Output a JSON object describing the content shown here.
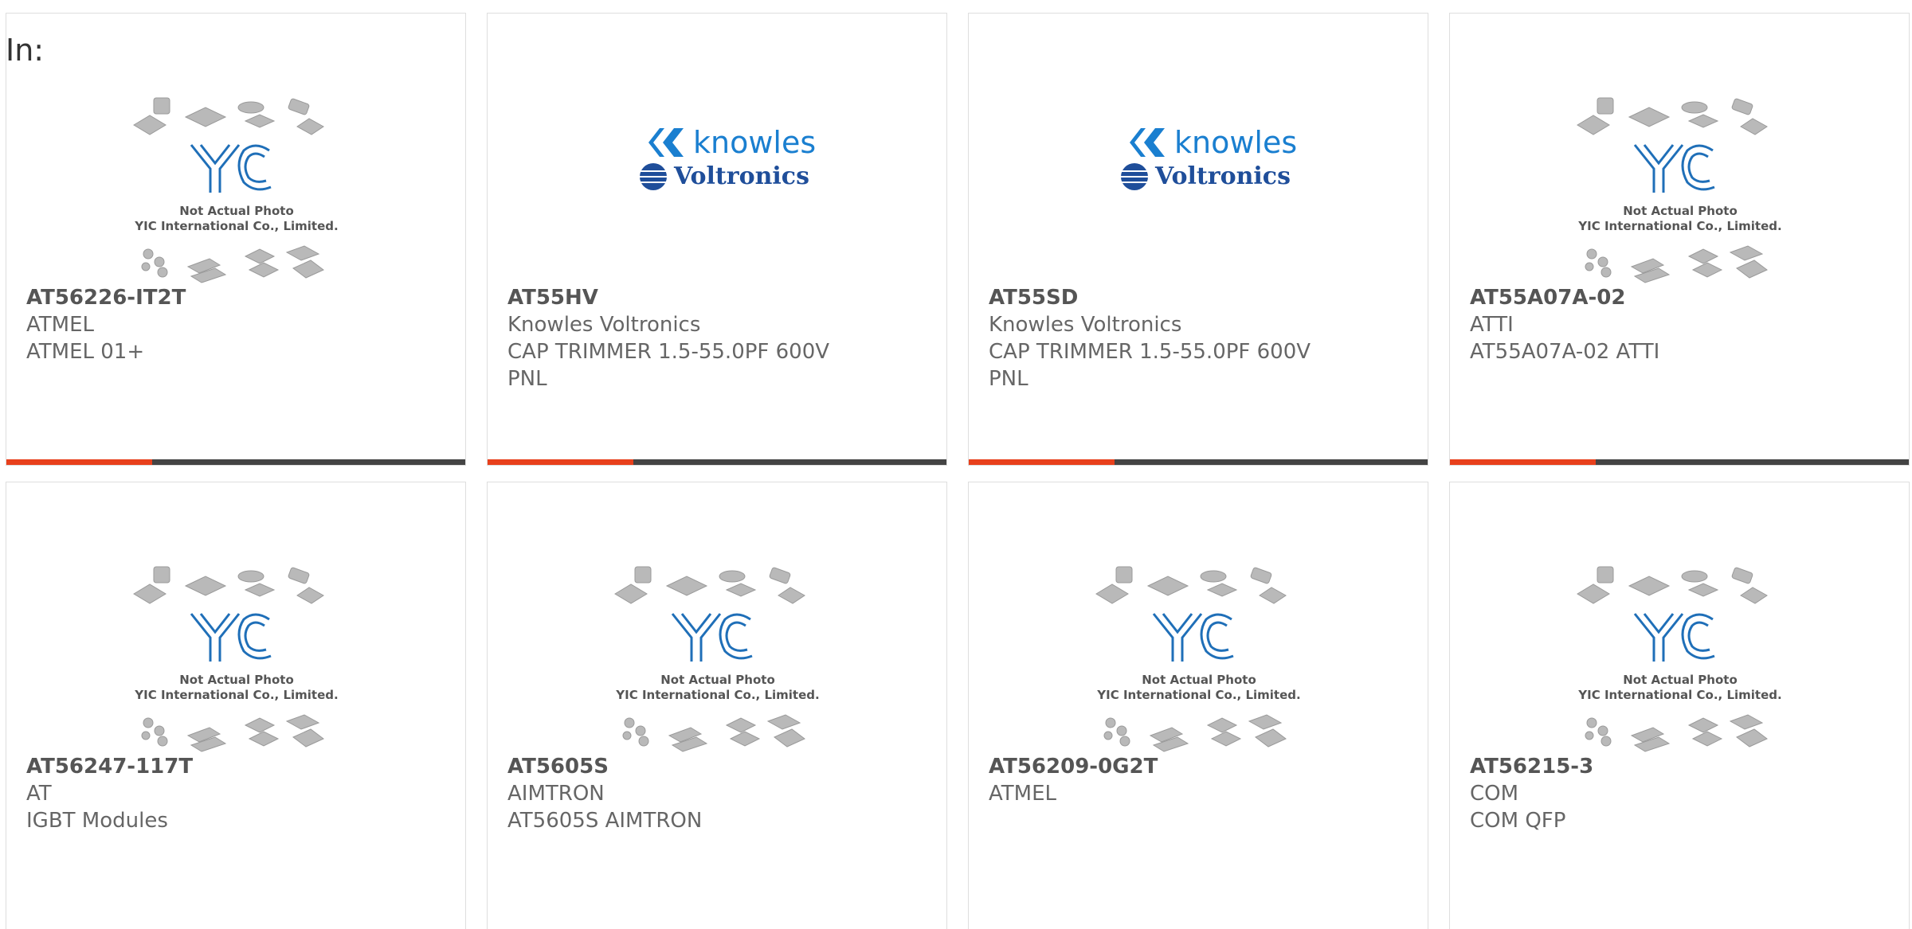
{
  "header": {
    "in_label": "In:"
  },
  "placeholder": {
    "line1": "Not Actual Photo",
    "line2": "YIC International Co., Limited.",
    "logo_text": "YIC"
  },
  "knowles_logo": {
    "brand": "knowles",
    "sub": "Voltronics"
  },
  "colors": {
    "accent": "#e8401c",
    "bar": "#444444",
    "logo_blue": "#1a7fd0"
  },
  "products": [
    {
      "part": "AT56226-IT2T",
      "maker": "ATMEL",
      "desc": "ATMEL 01+",
      "desc2": "",
      "image": "placeholder"
    },
    {
      "part": "AT55HV",
      "maker": "Knowles Voltronics",
      "desc": "CAP TRIMMER 1.5-55.0PF 600V",
      "desc2": "PNL",
      "image": "knowles"
    },
    {
      "part": "AT55SD",
      "maker": "Knowles Voltronics",
      "desc": "CAP TRIMMER 1.5-55.0PF 600V",
      "desc2": "PNL",
      "image": "knowles"
    },
    {
      "part": "AT55A07A-02",
      "maker": "ATTI",
      "desc": "AT55A07A-02 ATTI",
      "desc2": "",
      "image": "placeholder"
    },
    {
      "part": "AT56247-117T",
      "maker": "AT",
      "desc": "IGBT Modules",
      "desc2": "",
      "image": "placeholder"
    },
    {
      "part": "AT5605S",
      "maker": "AIMTRON",
      "desc": "AT5605S AIMTRON",
      "desc2": "",
      "image": "placeholder"
    },
    {
      "part": "AT56209-0G2T",
      "maker": "ATMEL",
      "desc": "",
      "desc2": "",
      "image": "placeholder"
    },
    {
      "part": "AT56215-3",
      "maker": "COM",
      "desc": "COM QFP",
      "desc2": "",
      "image": "placeholder"
    }
  ]
}
